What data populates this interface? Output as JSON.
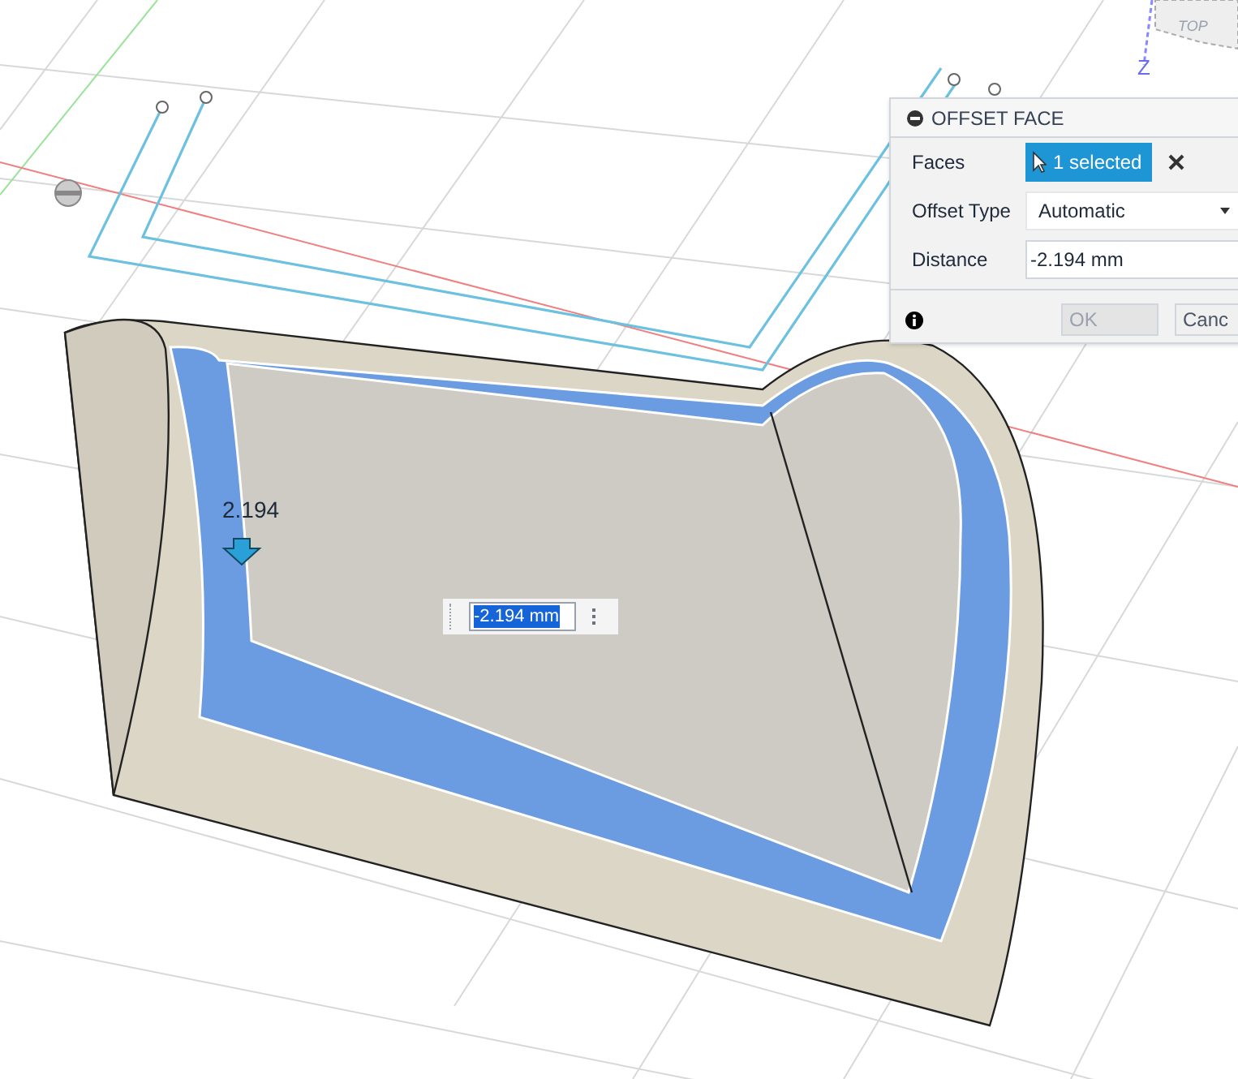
{
  "viewcube": {
    "face_label": "TOP",
    "axis_label": "Z"
  },
  "dimension": {
    "label": "2.194"
  },
  "inline_input": {
    "value": "-2.194 mm"
  },
  "dialog": {
    "title": "OFFSET FACE",
    "rows": [
      {
        "kind": "selection",
        "label": "Faces",
        "value": "1 selected"
      },
      {
        "kind": "dropdown",
        "label": "Offset Type",
        "value": "Automatic"
      },
      {
        "kind": "input",
        "label": "Distance",
        "value": "-2.194 mm"
      }
    ],
    "buttons": [
      "OK",
      "Canc"
    ]
  }
}
